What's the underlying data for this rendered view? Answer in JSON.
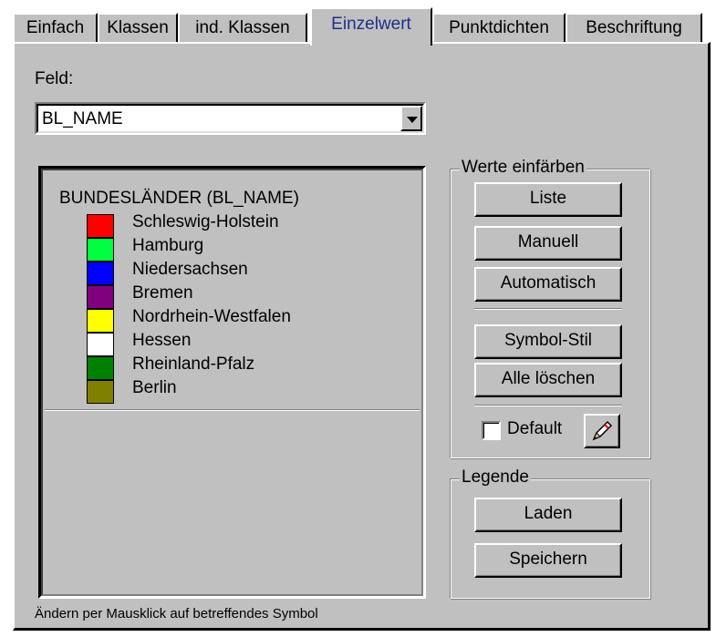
{
  "tabs": [
    {
      "label": "Einfach",
      "active": false
    },
    {
      "label": "Klassen",
      "active": false
    },
    {
      "label": "ind. Klassen",
      "active": false
    },
    {
      "label": "Einzelwert",
      "active": true
    },
    {
      "label": "Punktdichten",
      "active": false
    },
    {
      "label": "Beschriftung",
      "active": false
    }
  ],
  "field": {
    "label": "Feld:",
    "value": "BL_NAME"
  },
  "legend": {
    "title": "BUNDESLÄNDER (BL_NAME)",
    "items": [
      {
        "label": "Schleswig-Holstein",
        "color": "#ff0000"
      },
      {
        "label": "Hamburg",
        "color": "#00ff40"
      },
      {
        "label": "Niedersachsen",
        "color": "#0000ff"
      },
      {
        "label": "Bremen",
        "color": "#800080"
      },
      {
        "label": "Nordrhein-Westfalen",
        "color": "#ffff00"
      },
      {
        "label": "Hessen",
        "color": "#ffffff"
      },
      {
        "label": "Rheinland-Pfalz",
        "color": "#008000"
      },
      {
        "label": "Berlin",
        "color": "#808000"
      }
    ]
  },
  "werte_group": {
    "caption": "Werte einfärben",
    "buttons": {
      "liste": "Liste",
      "manuell": "Manuell",
      "automatisch": "Automatisch",
      "symbol_stil": "Symbol-Stil",
      "alle_loeschen": "Alle löschen"
    },
    "default_label": "Default",
    "default_checked": false
  },
  "legende_group": {
    "caption": "Legende",
    "buttons": {
      "laden": "Laden",
      "speichern": "Speichern"
    }
  },
  "footer": {
    "hint": "Ändern per Mausklick auf betreffendes Symbol"
  }
}
